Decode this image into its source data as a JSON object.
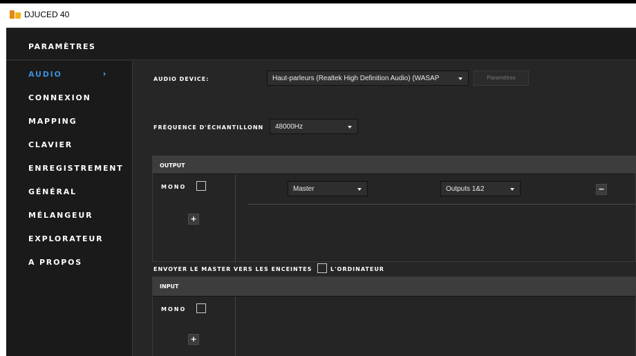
{
  "app": {
    "title": "DJUCED 40"
  },
  "window": {
    "title": "PARAMÈTRES"
  },
  "sidebar": {
    "items": [
      {
        "label": "AUDIO",
        "active": true
      },
      {
        "label": "CONNEXION"
      },
      {
        "label": "MAPPING"
      },
      {
        "label": "CLAVIER"
      },
      {
        "label": "ENREGISTREMENT"
      },
      {
        "label": "GÉNÉRAL"
      },
      {
        "label": "MÉLANGEUR"
      },
      {
        "label": "EXPLORATEUR"
      },
      {
        "label": "A PROPOS"
      }
    ]
  },
  "audio_device": {
    "label": "AUDIO DEVICE:",
    "value": "Haut-parleurs (Realtek High Definition Audio) (WASAP",
    "settings_button": "Paramètres"
  },
  "sample_rate": {
    "label": "FRÉQUENCE D'ÉCHANTILLONN",
    "value": "48000Hz"
  },
  "output": {
    "title": "OUTPUT",
    "mono_label": "MONO",
    "mono_checked": false,
    "add_label": "+",
    "routes": [
      {
        "source": "Master",
        "destination": "Outputs 1&2",
        "remove_label": "−"
      }
    ]
  },
  "send_master": {
    "label_before": "ENVOYER LE MASTER VERS LES ENCEINTES",
    "label_after": "L'ORDINATEUR",
    "checked": false
  },
  "input": {
    "title": "INPUT",
    "mono_label": "MONO",
    "mono_checked": false,
    "add_label": "+"
  },
  "colors": {
    "accent": "#3a8fd6",
    "background": "#262626",
    "sidebar": "#1a1a1a",
    "panel_header": "#3d3d3d"
  }
}
